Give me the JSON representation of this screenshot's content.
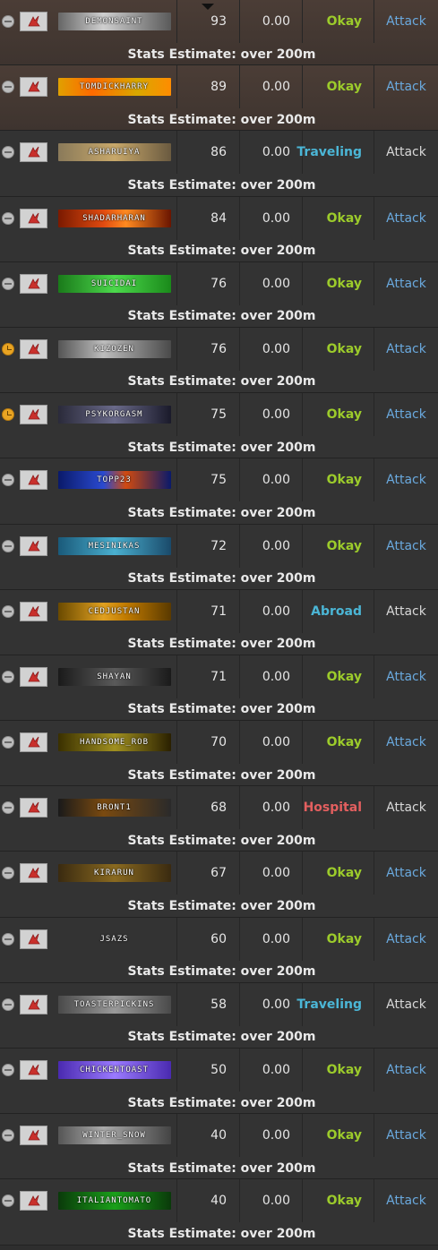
{
  "stats_prefix": "Stats Estimate:",
  "colors": {
    "okay": "#9ccb2b",
    "traveling": "#4bb6d6",
    "hospital": "#e35f5f",
    "attack_link": "#6aa9de"
  },
  "rows": [
    {
      "name": "DEMONSAINT",
      "level": "93",
      "money": "0.00",
      "status": "Okay",
      "status_kind": "okay",
      "attack": "Attack",
      "attack_active": true,
      "icon": "minus",
      "banner": "linear-gradient(90deg,#666,#cfcfcf 40%,#5a5a5a)",
      "stats": "Stats Estimate: over 200m"
    },
    {
      "name": "TOMDICKHARRY",
      "level": "89",
      "money": "0.00",
      "status": "Okay",
      "status_kind": "okay",
      "attack": "Attack",
      "attack_active": true,
      "icon": "minus",
      "banner": "linear-gradient(90deg,#e0a000,#ff6a00 30%,#d9a800 70%,#ff8c00)",
      "stats": "Stats Estimate: over 200m"
    },
    {
      "name": "ASHARUIYA",
      "level": "86",
      "money": "0.00",
      "status": "Traveling",
      "status_kind": "traveling",
      "attack": "Attack",
      "attack_active": false,
      "icon": "minus",
      "banner": "linear-gradient(90deg,#8a7a5a,#c8a86a 50%,#6a5a40)",
      "stats": "Stats Estimate: over 200m"
    },
    {
      "name": "SHADARHARAN",
      "level": "84",
      "money": "0.00",
      "status": "Okay",
      "status_kind": "okay",
      "attack": "Attack",
      "attack_active": true,
      "icon": "minus",
      "banner": "linear-gradient(90deg,#7a1a00,#e04a10 40%,#ff8a20 60%,#6a1500)",
      "stats": "Stats Estimate: over 200m"
    },
    {
      "name": "SUICIDAI",
      "level": "76",
      "money": "0.00",
      "status": "Okay",
      "status_kind": "okay",
      "attack": "Attack",
      "attack_active": true,
      "icon": "minus",
      "banner": "linear-gradient(90deg,#1a7a1a,#4cd94c 50%,#1a8a1a)",
      "stats": "Stats Estimate: over 200m"
    },
    {
      "name": "KIZOZEN",
      "level": "76",
      "money": "0.00",
      "status": "Okay",
      "status_kind": "okay",
      "attack": "Attack",
      "attack_active": true,
      "icon": "clock",
      "banner": "linear-gradient(90deg,#555,#bdbdbd 40%,#4a4a4a)",
      "stats": "Stats Estimate: over 200m"
    },
    {
      "name": "PSYKORGASM",
      "level": "75",
      "money": "0.00",
      "status": "Okay",
      "status_kind": "okay",
      "attack": "Attack",
      "attack_active": true,
      "icon": "clock",
      "banner": "linear-gradient(90deg,#2a2a3a,#6a6a8a 50%,#1a1a2a)",
      "stats": "Stats Estimate: over 200m"
    },
    {
      "name": "TOPP23",
      "level": "75",
      "money": "0.00",
      "status": "Okay",
      "status_kind": "okay",
      "attack": "Attack",
      "attack_active": true,
      "icon": "minus",
      "banner": "linear-gradient(90deg,#0a1a6a,#2a4ad0 40%,#d04a10 60%,#0a1a6a)",
      "stats": "Stats Estimate: over 200m"
    },
    {
      "name": "MESINIKAS",
      "level": "72",
      "money": "0.00",
      "status": "Okay",
      "status_kind": "okay",
      "attack": "Attack",
      "attack_active": true,
      "icon": "minus",
      "banner": "linear-gradient(90deg,#1a5a7a,#4ab0d0 50%,#1a4a6a)",
      "stats": "Stats Estimate: over 200m"
    },
    {
      "name": "CEDJUSTAN",
      "level": "71",
      "money": "0.00",
      "status": "Abroad",
      "status_kind": "abroad",
      "attack": "Attack",
      "attack_active": false,
      "icon": "minus",
      "banner": "linear-gradient(90deg,#6a4a00,#e0a020 40%,#c07a00 60%,#5a3a00)",
      "stats": "Stats Estimate: over 200m"
    },
    {
      "name": "SHAYAN",
      "level": "71",
      "money": "0.00",
      "status": "Okay",
      "status_kind": "okay",
      "attack": "Attack",
      "attack_active": true,
      "icon": "minus",
      "banner": "linear-gradient(90deg,#1a1a1a,#5a5a5a 50%,#1a1a1a)",
      "stats": "Stats Estimate: over 200m"
    },
    {
      "name": "HANDSOME_ROB",
      "level": "70",
      "money": "0.00",
      "status": "Okay",
      "status_kind": "okay",
      "attack": "Attack",
      "attack_active": true,
      "icon": "minus",
      "banner": "linear-gradient(90deg,#3a3000,#a09020 50%,#2a2000)",
      "stats": "Stats Estimate: over 200m"
    },
    {
      "name": "BRONT1",
      "level": "68",
      "money": "0.00",
      "status": "Hospital",
      "status_kind": "hospital",
      "attack": "Attack",
      "attack_active": false,
      "icon": "minus",
      "banner": "linear-gradient(90deg,#1a1a1a,#7a4a10 40%,#2a2a2a)",
      "stats": "Stats Estimate: over 200m"
    },
    {
      "name": "KIRARUN",
      "level": "67",
      "money": "0.00",
      "status": "Okay",
      "status_kind": "okay",
      "attack": "Attack",
      "attack_active": true,
      "icon": "minus",
      "banner": "linear-gradient(90deg,#3a2a10,#8a6a20 50%,#3a2a10)",
      "stats": "Stats Estimate: over 200m"
    },
    {
      "name": "JSAZS",
      "level": "60",
      "money": "0.00",
      "status": "Okay",
      "status_kind": "okay",
      "attack": "Attack",
      "attack_active": true,
      "icon": "minus",
      "banner": "linear-gradient(90deg,#333,#333)",
      "stats": "Stats Estimate: over 200m"
    },
    {
      "name": "TOASTERPICKINS",
      "level": "58",
      "money": "0.00",
      "status": "Traveling",
      "status_kind": "traveling",
      "attack": "Attack",
      "attack_active": false,
      "icon": "minus",
      "banner": "linear-gradient(90deg,#4a4a4a,#9a9a9a 50%,#4a4a4a)",
      "stats": "Stats Estimate: over 200m"
    },
    {
      "name": "CHICKENTOAST",
      "level": "50",
      "money": "0.00",
      "status": "Okay",
      "status_kind": "okay",
      "attack": "Attack",
      "attack_active": true,
      "icon": "minus",
      "banner": "linear-gradient(90deg,#4a2ab0,#9a7aff 50%,#4a2ab0)",
      "stats": "Stats Estimate: over 200m"
    },
    {
      "name": "WINTER_SNOW",
      "level": "40",
      "money": "0.00",
      "status": "Okay",
      "status_kind": "okay",
      "attack": "Attack",
      "attack_active": true,
      "icon": "minus",
      "banner": "linear-gradient(90deg,#555,#aaaaaa 40%,#444)",
      "stats": "Stats Estimate: over 200m"
    },
    {
      "name": "ITALIANTOMATO",
      "level": "40",
      "money": "0.00",
      "status": "Okay",
      "status_kind": "okay",
      "attack": "Attack",
      "attack_active": true,
      "icon": "minus",
      "banner": "linear-gradient(90deg,#0a3a0a,#1aa01a 50%,#0a3a0a)",
      "stats": "Stats Estimate: over 200m"
    }
  ]
}
